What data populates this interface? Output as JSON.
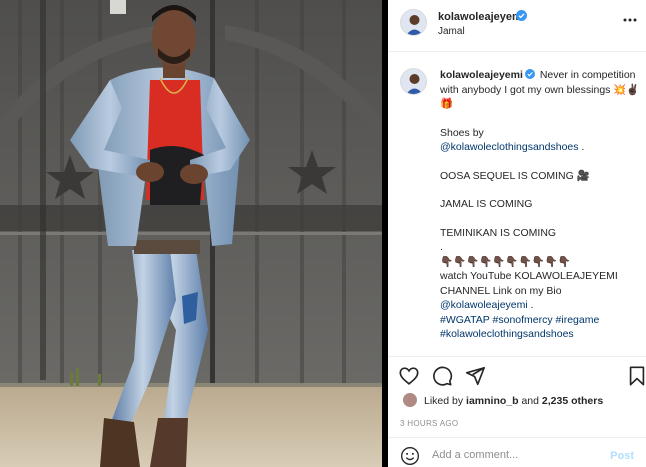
{
  "post": {
    "username": "kolawoleajeyemi",
    "location": "Jamal",
    "colors": {
      "verified": "#3897f0",
      "link": "#00376b",
      "post_button": "#b2dffc"
    }
  },
  "caption": {
    "username": "kolawoleajeyemi",
    "text_line1": "Never in competition with anybody I got my own blessings 💥✌🏿🎁",
    "shoes_by": "Shoes by",
    "shoes_link": "@kolawoleclothingsandshoes",
    "shoes_suffix": " .",
    "line_oosa": "OOSA SEQUEL IS COMING 🎥",
    "line_jamal": "JAMAL IS COMING",
    "line_teminikan": "TEMINIKAN IS COMING",
    "dot": ".",
    "pointing": "👇🏿👇🏿👇🏿👇🏿👇🏿👇🏿👇🏿👇🏿👇🏿👇🏿",
    "watch": "watch YouTube KOLAWOLEAJEYEMI CHANNEL Link on my Bio",
    "bio_link": "@kolawoleajeyemi",
    "bio_suffix": " .",
    "hashtags": "#WGATAP #sonofmercy #iregame #kolawoleclothingsandshoes"
  },
  "icons": {
    "more": "more-icon",
    "like": "heart-icon",
    "comment": "comment-icon",
    "share": "share-icon",
    "save": "bookmark-icon",
    "emoji": "emoji-icon",
    "verified": "verified-badge-icon"
  },
  "likes": {
    "prefix": "Liked by ",
    "first_user": "iamnino_b",
    "middle": " and ",
    "others": "2,235 others"
  },
  "time": "3 HOURS AGO",
  "comment_box": {
    "placeholder": "Add a comment...",
    "post_label": "Post"
  }
}
